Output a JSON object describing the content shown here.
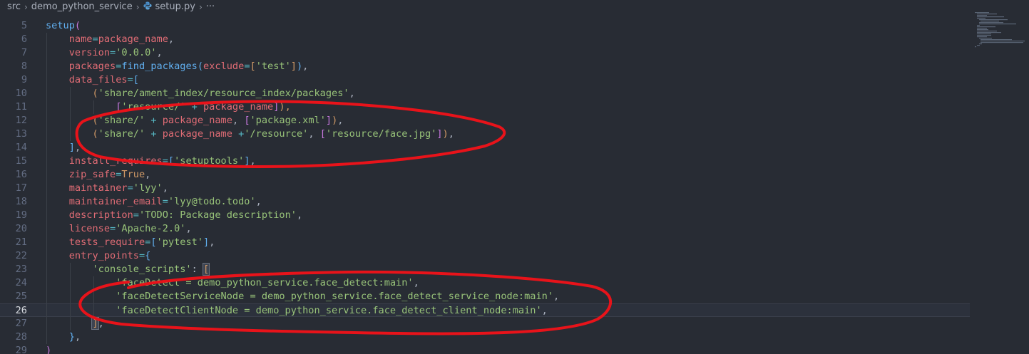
{
  "breadcrumb": {
    "items": [
      "src",
      "demo_python_service",
      "setup.py",
      "···"
    ]
  },
  "colors": {
    "background": "#282c34",
    "annotation": "#e8131a"
  },
  "editor": {
    "current_line": 26,
    "lines": [
      {
        "n": "5",
        "tokens": [
          {
            "t": "setup",
            "c": "fn"
          },
          {
            "t": "(",
            "c": "br1"
          }
        ]
      },
      {
        "n": "6",
        "tokens": [
          {
            "t": "    ",
            "c": "plain"
          },
          {
            "t": "name",
            "c": "kw"
          },
          {
            "t": "=",
            "c": "op"
          },
          {
            "t": "package_name",
            "c": "kw"
          },
          {
            "t": ",",
            "c": "plain"
          }
        ]
      },
      {
        "n": "7",
        "tokens": [
          {
            "t": "    ",
            "c": "plain"
          },
          {
            "t": "version",
            "c": "kw"
          },
          {
            "t": "=",
            "c": "op"
          },
          {
            "t": "'0.0.0'",
            "c": "str"
          },
          {
            "t": ",",
            "c": "plain"
          }
        ]
      },
      {
        "n": "8",
        "tokens": [
          {
            "t": "    ",
            "c": "plain"
          },
          {
            "t": "packages",
            "c": "kw"
          },
          {
            "t": "=",
            "c": "op"
          },
          {
            "t": "find_packages",
            "c": "fn"
          },
          {
            "t": "(",
            "c": "br2"
          },
          {
            "t": "exclude",
            "c": "kw"
          },
          {
            "t": "=",
            "c": "op"
          },
          {
            "t": "[",
            "c": "br3"
          },
          {
            "t": "'test'",
            "c": "str"
          },
          {
            "t": "]",
            "c": "br3"
          },
          {
            "t": ")",
            "c": "br2"
          },
          {
            "t": ",",
            "c": "plain"
          }
        ]
      },
      {
        "n": "9",
        "tokens": [
          {
            "t": "    ",
            "c": "plain"
          },
          {
            "t": "data_files",
            "c": "kw"
          },
          {
            "t": "=",
            "c": "op"
          },
          {
            "t": "[",
            "c": "br2"
          }
        ]
      },
      {
        "n": "10",
        "tokens": [
          {
            "t": "        ",
            "c": "plain"
          },
          {
            "t": "(",
            "c": "br3"
          },
          {
            "t": "'share/ament_index/resource_index/packages'",
            "c": "str"
          },
          {
            "t": ",",
            "c": "plain"
          }
        ]
      },
      {
        "n": "11",
        "tokens": [
          {
            "t": "            ",
            "c": "plain"
          },
          {
            "t": "[",
            "c": "br1"
          },
          {
            "t": "'resource/'",
            "c": "str"
          },
          {
            "t": " + ",
            "c": "op"
          },
          {
            "t": "package_name",
            "c": "kw"
          },
          {
            "t": "]",
            "c": "br1"
          },
          {
            "t": "),",
            "c": "br3"
          }
        ]
      },
      {
        "n": "12",
        "tokens": [
          {
            "t": "        ",
            "c": "plain"
          },
          {
            "t": "(",
            "c": "br3"
          },
          {
            "t": "'share/'",
            "c": "str"
          },
          {
            "t": " + ",
            "c": "op"
          },
          {
            "t": "package_name",
            "c": "kw"
          },
          {
            "t": ", ",
            "c": "plain"
          },
          {
            "t": "[",
            "c": "br1"
          },
          {
            "t": "'package.xml'",
            "c": "str"
          },
          {
            "t": "]",
            "c": "br1"
          },
          {
            "t": ")",
            "c": "br3"
          },
          {
            "t": ",",
            "c": "plain"
          }
        ]
      },
      {
        "n": "13",
        "tokens": [
          {
            "t": "        ",
            "c": "plain"
          },
          {
            "t": "(",
            "c": "br3"
          },
          {
            "t": "'share/'",
            "c": "str"
          },
          {
            "t": " + ",
            "c": "op"
          },
          {
            "t": "package_name",
            "c": "kw"
          },
          {
            "t": " +",
            "c": "op"
          },
          {
            "t": "'/resource'",
            "c": "str"
          },
          {
            "t": ", ",
            "c": "plain"
          },
          {
            "t": "[",
            "c": "br1"
          },
          {
            "t": "'resource/face.jpg'",
            "c": "str"
          },
          {
            "t": "]",
            "c": "br1"
          },
          {
            "t": ")",
            "c": "br3"
          },
          {
            "t": ",",
            "c": "plain"
          }
        ]
      },
      {
        "n": "14",
        "tokens": [
          {
            "t": "    ",
            "c": "plain"
          },
          {
            "t": "]",
            "c": "br2"
          },
          {
            "t": ",",
            "c": "plain"
          }
        ]
      },
      {
        "n": "15",
        "tokens": [
          {
            "t": "    ",
            "c": "plain"
          },
          {
            "t": "install_requires",
            "c": "kw"
          },
          {
            "t": "=",
            "c": "op"
          },
          {
            "t": "[",
            "c": "br2"
          },
          {
            "t": "'setuptools'",
            "c": "str"
          },
          {
            "t": "]",
            "c": "br2"
          },
          {
            "t": ",",
            "c": "plain"
          }
        ]
      },
      {
        "n": "16",
        "tokens": [
          {
            "t": "    ",
            "c": "plain"
          },
          {
            "t": "zip_safe",
            "c": "kw"
          },
          {
            "t": "=",
            "c": "op"
          },
          {
            "t": "True",
            "c": "num"
          },
          {
            "t": ",",
            "c": "plain"
          }
        ]
      },
      {
        "n": "17",
        "tokens": [
          {
            "t": "    ",
            "c": "plain"
          },
          {
            "t": "maintainer",
            "c": "kw"
          },
          {
            "t": "=",
            "c": "op"
          },
          {
            "t": "'lyy'",
            "c": "str"
          },
          {
            "t": ",",
            "c": "plain"
          }
        ]
      },
      {
        "n": "18",
        "tokens": [
          {
            "t": "    ",
            "c": "plain"
          },
          {
            "t": "maintainer_email",
            "c": "kw"
          },
          {
            "t": "=",
            "c": "op"
          },
          {
            "t": "'lyy@todo.todo'",
            "c": "str"
          },
          {
            "t": ",",
            "c": "plain"
          }
        ]
      },
      {
        "n": "19",
        "tokens": [
          {
            "t": "    ",
            "c": "plain"
          },
          {
            "t": "description",
            "c": "kw"
          },
          {
            "t": "=",
            "c": "op"
          },
          {
            "t": "'TODO: Package description'",
            "c": "str"
          },
          {
            "t": ",",
            "c": "plain"
          }
        ]
      },
      {
        "n": "20",
        "tokens": [
          {
            "t": "    ",
            "c": "plain"
          },
          {
            "t": "license",
            "c": "kw"
          },
          {
            "t": "=",
            "c": "op"
          },
          {
            "t": "'Apache-2.0'",
            "c": "str"
          },
          {
            "t": ",",
            "c": "plain"
          }
        ]
      },
      {
        "n": "21",
        "tokens": [
          {
            "t": "    ",
            "c": "plain"
          },
          {
            "t": "tests_require",
            "c": "kw"
          },
          {
            "t": "=",
            "c": "op"
          },
          {
            "t": "[",
            "c": "br2"
          },
          {
            "t": "'pytest'",
            "c": "str"
          },
          {
            "t": "]",
            "c": "br2"
          },
          {
            "t": ",",
            "c": "plain"
          }
        ]
      },
      {
        "n": "22",
        "tokens": [
          {
            "t": "    ",
            "c": "plain"
          },
          {
            "t": "entry_points",
            "c": "kw"
          },
          {
            "t": "=",
            "c": "op"
          },
          {
            "t": "{",
            "c": "br2"
          }
        ]
      },
      {
        "n": "23",
        "tokens": [
          {
            "t": "        ",
            "c": "plain"
          },
          {
            "t": "'console_scripts'",
            "c": "str"
          },
          {
            "t": ": ",
            "c": "plain"
          },
          {
            "t": "[",
            "c": "br3",
            "match": true
          }
        ]
      },
      {
        "n": "24",
        "tokens": [
          {
            "t": "            ",
            "c": "plain"
          },
          {
            "t": "'faceDetect = demo_python_service.face_detect:main'",
            "c": "str"
          },
          {
            "t": ",",
            "c": "plain"
          }
        ]
      },
      {
        "n": "25",
        "tokens": [
          {
            "t": "            ",
            "c": "plain"
          },
          {
            "t": "'faceDetectServiceNode = demo_python_service.face_detect_service_node:main'",
            "c": "str"
          },
          {
            "t": ",",
            "c": "plain"
          }
        ]
      },
      {
        "n": "26",
        "tokens": [
          {
            "t": "            ",
            "c": "plain"
          },
          {
            "t": "'faceDetectClientNode = demo_python_service.face_detect_client_node:main'",
            "c": "str"
          },
          {
            "t": ",",
            "c": "plain"
          }
        ]
      },
      {
        "n": "27",
        "tokens": [
          {
            "t": "        ",
            "c": "plain"
          },
          {
            "t": "]",
            "c": "br3",
            "match": true
          },
          {
            "t": ",",
            "c": "plain"
          }
        ]
      },
      {
        "n": "28",
        "tokens": [
          {
            "t": "    ",
            "c": "plain"
          },
          {
            "t": "}",
            "c": "br2"
          },
          {
            "t": ",",
            "c": "plain"
          }
        ]
      },
      {
        "n": "29",
        "tokens": [
          {
            "t": ")",
            "c": "br1"
          }
        ]
      }
    ]
  }
}
